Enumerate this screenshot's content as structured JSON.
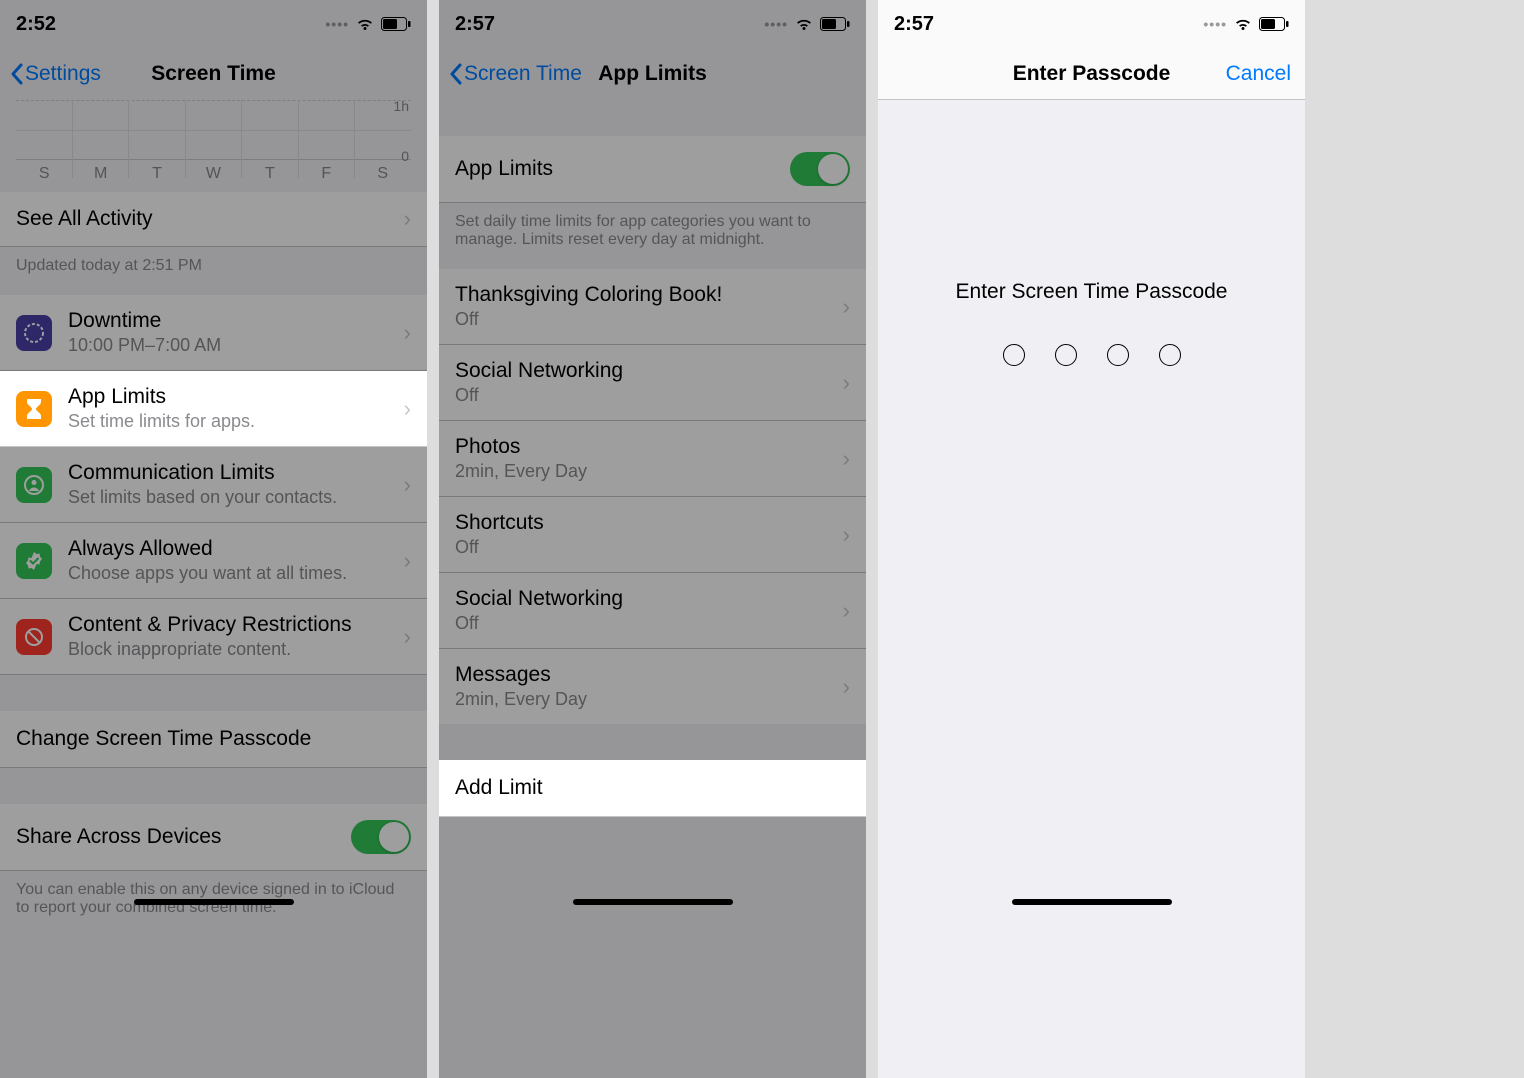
{
  "screen1": {
    "status": {
      "time": "2:52"
    },
    "nav": {
      "back": "Settings",
      "title": "Screen Time"
    },
    "chart": {
      "label_1h": "1h",
      "label_0": "0",
      "days": [
        "S",
        "M",
        "T",
        "W",
        "T",
        "F",
        "S"
      ]
    },
    "see_all": "See All Activity",
    "updated": "Updated today at 2:51 PM",
    "items": [
      {
        "title": "Downtime",
        "sub": "10:00 PM–7:00 AM"
      },
      {
        "title": "App Limits",
        "sub": "Set time limits for apps."
      },
      {
        "title": "Communication Limits",
        "sub": "Set limits based on your contacts."
      },
      {
        "title": "Always Allowed",
        "sub": "Choose apps you want at all times."
      },
      {
        "title": "Content & Privacy Restrictions",
        "sub": "Block inappropriate content."
      }
    ],
    "change_passcode": "Change Screen Time Passcode",
    "share_across": "Share Across Devices",
    "share_footer": "You can enable this on any device signed in to iCloud to report your combined screen time."
  },
  "screen2": {
    "status": {
      "time": "2:57"
    },
    "nav": {
      "back": "Screen Time",
      "title": "App Limits"
    },
    "toggle_label": "App Limits",
    "toggle_footer": "Set daily time limits for app categories you want to manage. Limits reset every day at midnight.",
    "limits": [
      {
        "title": "Thanksgiving Coloring Book!",
        "sub": "Off"
      },
      {
        "title": "Social Networking",
        "sub": "Off"
      },
      {
        "title": "Photos",
        "sub": "2min, Every Day"
      },
      {
        "title": "Shortcuts",
        "sub": "Off"
      },
      {
        "title": "Social Networking",
        "sub": "Off"
      },
      {
        "title": "Messages",
        "sub": "2min, Every Day"
      }
    ],
    "add_limit": "Add Limit"
  },
  "screen3": {
    "status": {
      "time": "2:57"
    },
    "nav": {
      "title": "Enter Passcode",
      "cancel": "Cancel"
    },
    "prompt": "Enter Screen Time Passcode"
  }
}
